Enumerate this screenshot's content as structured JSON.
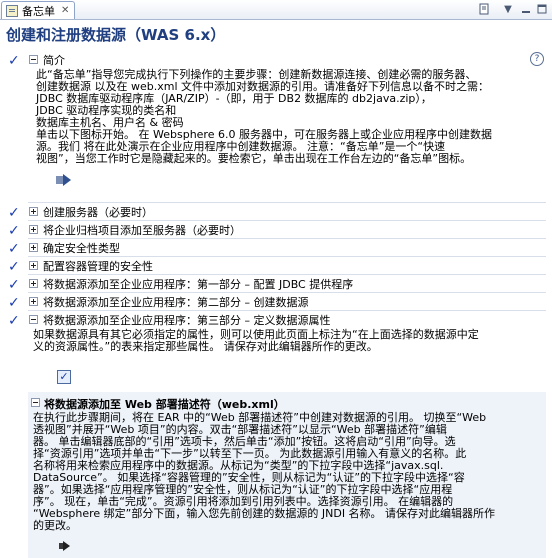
{
  "tab": {
    "label": "备忘单",
    "close": "✕"
  },
  "title": "创建和注册数据源（WAS 6.x）",
  "intro": {
    "heading": "简介",
    "lines": [
      "此“备忘单”指导您完成执行下列操作的主要步骤：创建新数据源连接、创建必需的服务器、",
      "创建数据源 以及在 web.xml 文件中添加对数据源的引用。请准备好下列信息以备不时之需：",
      "JDBC 数据库驱动程序库（JAR/ZIP）-（即，用于 DB2 数据库的 db2java.zip），",
      "JDBC 驱动程序实现的类名和",
      "数据库主机名、用户名 & 密码",
      "单击以下图标开始。 在 Websphere 6.0 服务器中，可在服务器上或企业应用程序中创建数据",
      "源。我们 将在此处演示在企业应用程序中创建数据源。 注意：“备忘单”是一个“快速",
      "视图”，当您工作时它是隐藏起来的。要检索它，单击出现在工作台左边的“备忘单”图标。"
    ]
  },
  "sections": [
    {
      "label": "创建服务器（必要时）",
      "checked": true,
      "expanded": false
    },
    {
      "label": "将企业归档项目添加至服务器（必要时）",
      "checked": true,
      "expanded": false
    },
    {
      "label": "确定安全性类型",
      "checked": true,
      "expanded": false
    },
    {
      "label": "配置容器管理的安全性",
      "checked": true,
      "expanded": false
    },
    {
      "label": "将数据源添加至企业应用程序：第一部分 – 配置 JDBC 提供程序",
      "checked": true,
      "expanded": false
    },
    {
      "label": "将数据源添加至企业应用程序：第二部分 – 创建数据源",
      "checked": true,
      "expanded": false
    },
    {
      "label": "将数据源添加至企业应用程序：第三部分 – 定义数据源属性",
      "checked": true,
      "expanded": true
    }
  ],
  "part3": {
    "lines": [
      "如果数据源具有其它必须指定的属性，则可以使用此页面上标注为“在上面选择的数据源中定",
      "义的资源属性。”的表来指定那些属性。 请保存对此编辑器所作的更改。"
    ],
    "completed_mark": "✓"
  },
  "sub": {
    "title": "将数据源添加至 Web 部署描述符（web.xml）",
    "lines": [
      "在执行此步骤期间，将在 EAR 中的“Web 部署描述符”中创建对数据源的引用。 切换至“Web",
      "透视图”并展开“Web 项目”的内容。双击“部署描述符”以显示“Web 部署描述符”编辑",
      "器。 单击编辑器底部的“引用”选项卡，然后单击“添加”按钮。这将启动“引用”向导。选",
      "择“资源引用”选项并单击“下一步”以转至下一页。 为此数据源引用输入有意义的名称。此",
      "名称将用来检索应用程序中的数据源。从标记为“类型”的下拉字段中选择“javax.sql.",
      "DataSource”。 如果选择“容器管理的”安全性，则从标记为“认证”的下拉字段中选择“容",
      "器”。如果选择“应用程序管理的”安全性，则从标记为“认证”的下拉字段中选择“应用程",
      "序”。 现在，单击“完成”。资源引用将添加到引用列表中。选择资源引用。 在编辑器的",
      "“Websphere 绑定”部分下面，输入您先前创建的数据源的 JNDI 名称。 请保存对此编辑器所作",
      "的更改。"
    ]
  },
  "icons": {
    "check": "✓",
    "help": "?",
    "accent": "#1a3cb0",
    "title_color": "#1f3f80"
  }
}
